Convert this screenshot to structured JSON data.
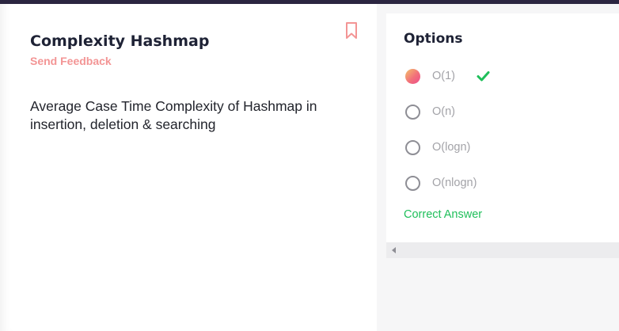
{
  "problem": {
    "title": "Complexity Hashmap",
    "feedback_link": "Send Feedback",
    "question": "Average Case Time Complexity of Hashmap in insertion, deletion & searching"
  },
  "options_panel": {
    "heading": "Options",
    "options": [
      {
        "label": "O(1)",
        "selected": true,
        "correct": true
      },
      {
        "label": "O(n)",
        "selected": false,
        "correct": false
      },
      {
        "label": "O(logn)",
        "selected": false,
        "correct": false
      },
      {
        "label": "O(nlogn)",
        "selected": false,
        "correct": false
      }
    ],
    "result_text": "Correct Answer"
  },
  "icons": {
    "bookmark": "bookmark-icon",
    "check": "checkmark-icon",
    "scroll_left": "chevron-left-icon"
  },
  "colors": {
    "accent": "#f39595",
    "success": "#1fbf5a",
    "title": "#1e2235",
    "top_bar": "#2b2540"
  }
}
